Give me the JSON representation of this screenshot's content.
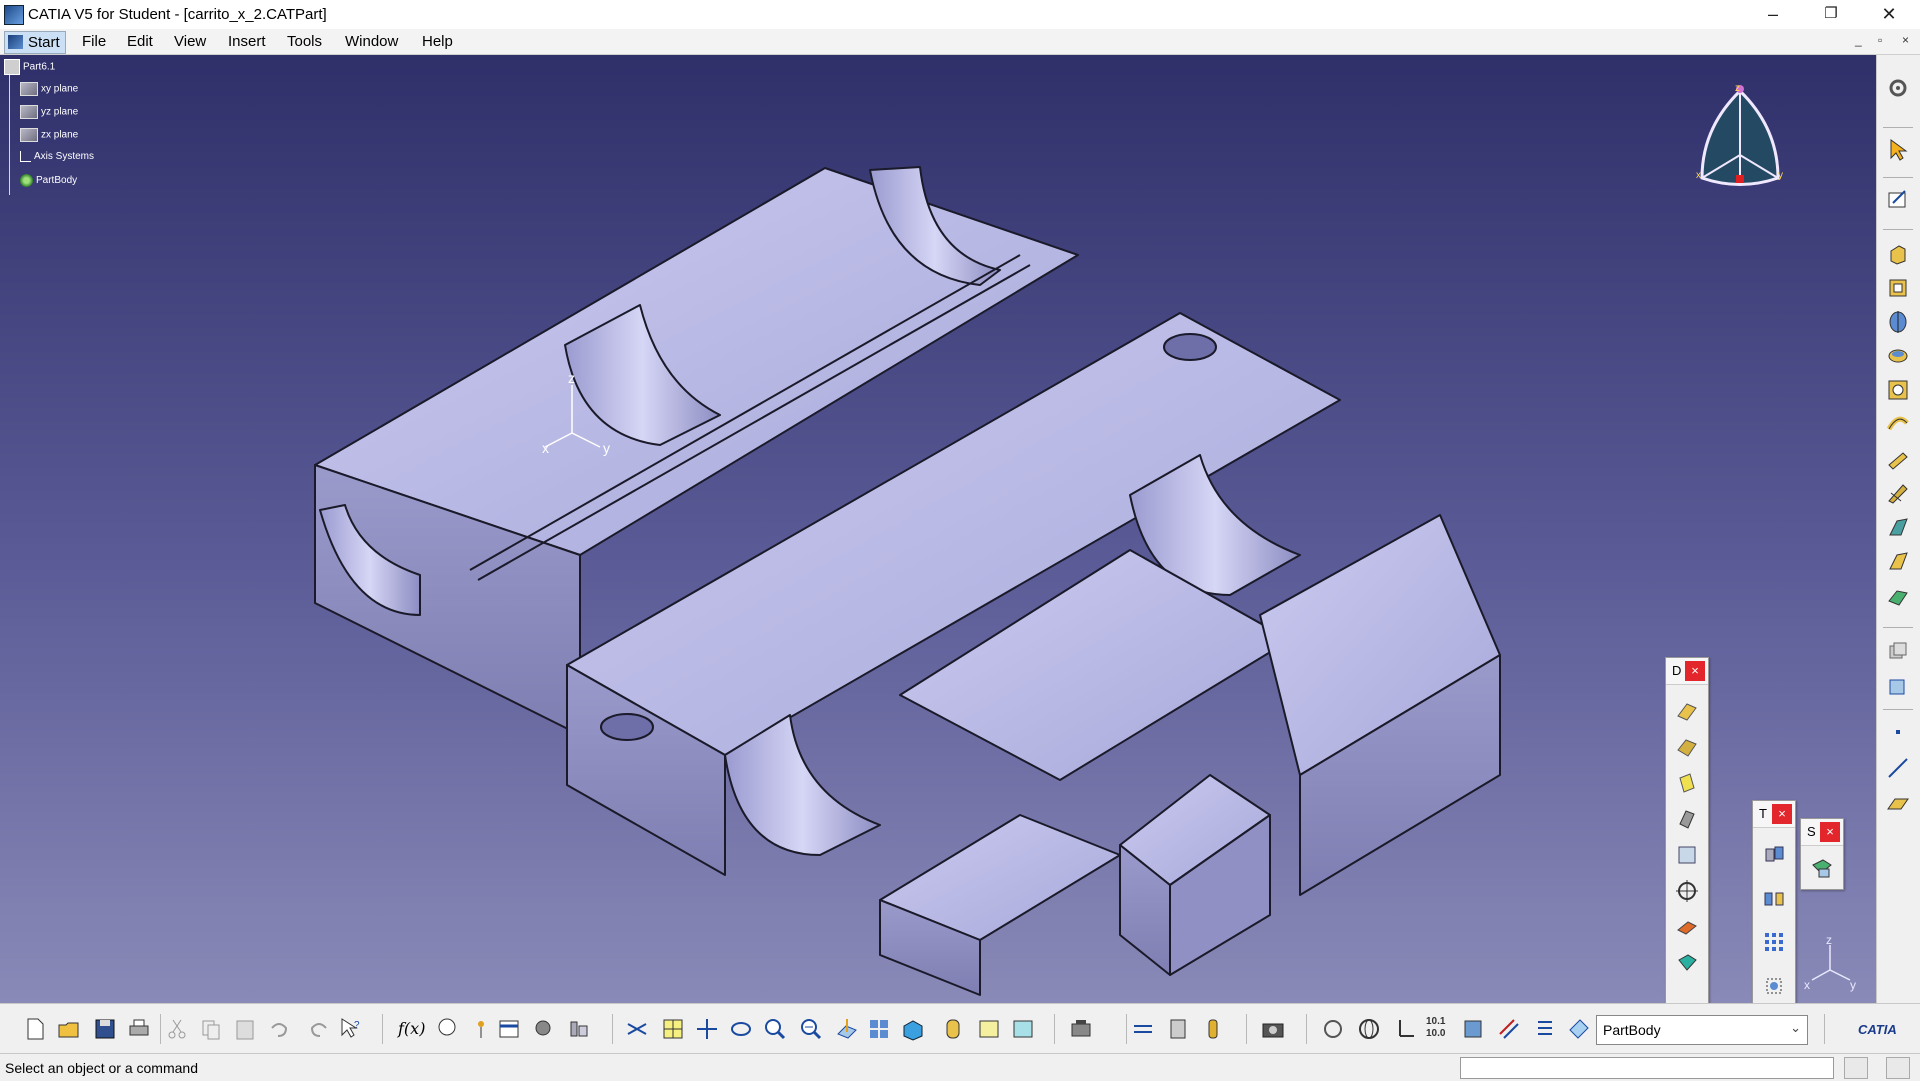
{
  "window": {
    "title": "CATIA V5 for Student - [carrito_x_2.CATPart]",
    "minimize_glyph": "–",
    "restore_glyph": "❐",
    "close_glyph": "✕"
  },
  "menu": {
    "items": [
      "Start",
      "File",
      "Edit",
      "View",
      "Insert",
      "Tools",
      "Window",
      "Help"
    ],
    "mdi_buttons": [
      "_",
      "▫",
      "×"
    ]
  },
  "tree": {
    "root": "Part6.1",
    "nodes": [
      "xy plane",
      "yz plane",
      "zx plane",
      "Axis Systems",
      "PartBody"
    ]
  },
  "viewport": {
    "axis_labels": [
      "x",
      "y",
      "z"
    ],
    "compass_labels": [
      "z",
      "x",
      "y"
    ]
  },
  "floating_toolbars": [
    {
      "letter": "D",
      "close": "×"
    },
    {
      "letter": "T",
      "close": "×"
    },
    {
      "letter": "S",
      "close": "×"
    }
  ],
  "bottom_toolbar": {
    "body_select_value": "PartBody",
    "fx_label": "f(x)",
    "brand": "CATIA"
  },
  "status": {
    "message": "Select an object or a command"
  },
  "colors": {
    "part_face_light": "#c6c6ee",
    "part_face_mid": "#a9a9d8",
    "part_face_dark": "#8484b8",
    "edge": "#1a1a2a",
    "close_red": "#e3262b"
  },
  "icons": [
    "catia-app-icon",
    "settings-icon",
    "select-arrow-icon",
    "sketcher-icon",
    "pad-icon",
    "pocket-icon",
    "shaft-icon",
    "groove-icon",
    "hole-icon",
    "rib-icon",
    "slot-icon",
    "stiffener-icon",
    "loft-icon",
    "point-icon",
    "line-icon",
    "plane-icon",
    "new-icon",
    "open-icon",
    "save-icon",
    "print-icon",
    "cut-icon",
    "copy-icon",
    "paste-icon",
    "undo-icon",
    "redo-icon",
    "help-icon",
    "formula-icon",
    "zoom-in-icon",
    "zoom-out-icon",
    "pan-icon",
    "rotate-icon",
    "fit-all-icon",
    "normal-view-icon",
    "iso-view-icon",
    "capture-icon",
    "chevron-down-icon"
  ]
}
